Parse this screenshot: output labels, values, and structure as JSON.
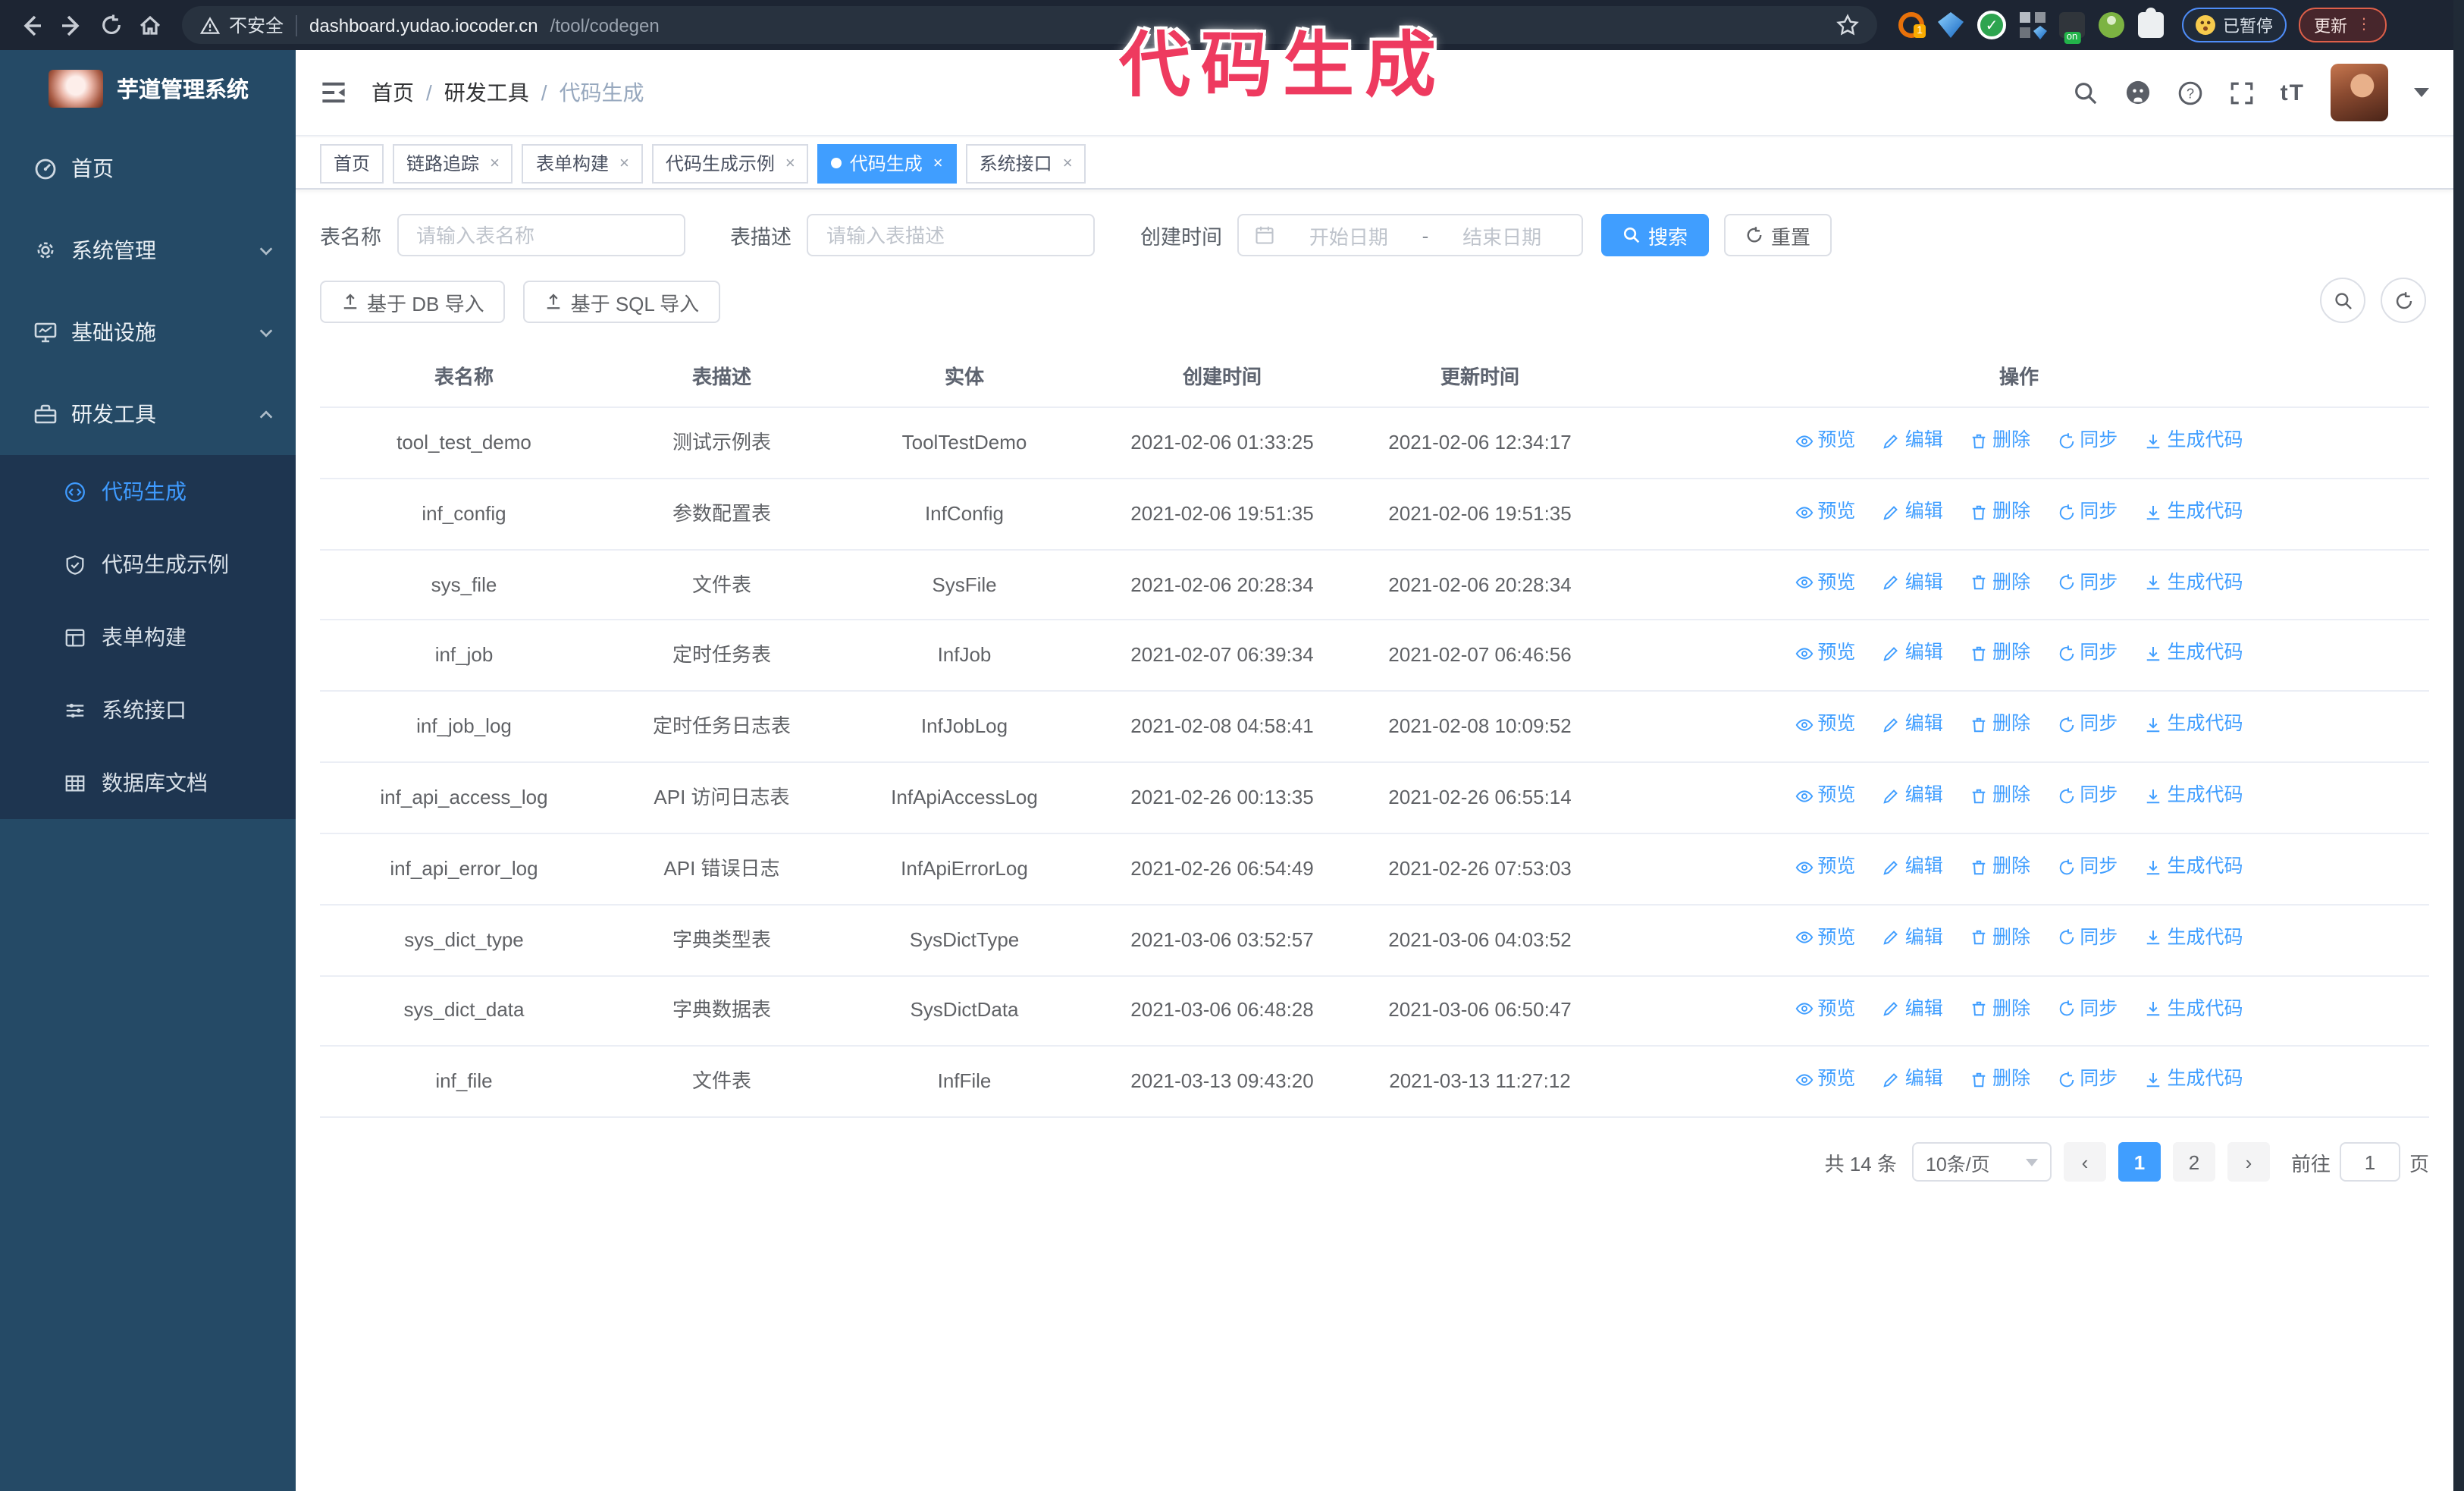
{
  "colors": {
    "accent": "#409eff",
    "sidebar_bg": "#254a66",
    "submenu_bg": "#1e3550",
    "chrome_bg": "#1d2533",
    "annotation": "#ee3a5f"
  },
  "browser": {
    "security_warning": "不安全",
    "url_host": "dashboard.yudao.iocoder.cn",
    "url_path": "/tool/codegen",
    "extension_badge": "1",
    "extension_on_badge": "on",
    "paused_badge": "已暂停",
    "update_button": "更新"
  },
  "annotation": {
    "text": "代码生成"
  },
  "sidebar": {
    "title": "芋道管理系统",
    "menu": [
      {
        "label": "首页",
        "icon": "dashboard-icon"
      },
      {
        "label": "系统管理",
        "icon": "gear-icon",
        "chevron": "down"
      },
      {
        "label": "基础设施",
        "icon": "monitor-icon",
        "chevron": "down"
      },
      {
        "label": "研发工具",
        "icon": "toolbox-icon",
        "chevron": "up"
      }
    ],
    "submenu": [
      {
        "label": "代码生成",
        "icon": "code-icon",
        "active": true
      },
      {
        "label": "代码生成示例",
        "icon": "example-icon"
      },
      {
        "label": "表单构建",
        "icon": "form-icon"
      },
      {
        "label": "系统接口",
        "icon": "api-icon"
      },
      {
        "label": "数据库文档",
        "icon": "database-icon"
      }
    ]
  },
  "breadcrumb": {
    "items": [
      "首页",
      "研发工具",
      "代码生成"
    ],
    "separator": "/"
  },
  "tabs": {
    "items": [
      {
        "label": "首页",
        "closable": false,
        "active": false
      },
      {
        "label": "链路追踪",
        "closable": true,
        "active": false
      },
      {
        "label": "表单构建",
        "closable": true,
        "active": false
      },
      {
        "label": "代码生成示例",
        "closable": true,
        "active": false
      },
      {
        "label": "代码生成",
        "closable": true,
        "active": true
      },
      {
        "label": "系统接口",
        "closable": true,
        "active": false
      }
    ]
  },
  "search": {
    "table_name_label": "表名称",
    "table_name_placeholder": "请输入表名称",
    "table_desc_label": "表描述",
    "table_desc_placeholder": "请输入表描述",
    "create_time_label": "创建时间",
    "date_start_placeholder": "开始日期",
    "date_separator": "-",
    "date_end_placeholder": "结束日期",
    "search_button": "搜索",
    "reset_button": "重置"
  },
  "toolbar": {
    "import_db_button": "基于 DB 导入",
    "import_sql_button": "基于 SQL 导入"
  },
  "table": {
    "columns": [
      "表名称",
      "表描述",
      "实体",
      "创建时间",
      "更新时间",
      "操作"
    ],
    "actions": [
      {
        "label": "预览",
        "icon": "eye-icon"
      },
      {
        "label": "编辑",
        "icon": "edit-icon"
      },
      {
        "label": "删除",
        "icon": "delete-icon"
      },
      {
        "label": "同步",
        "icon": "sync-icon"
      },
      {
        "label": "生成代码",
        "icon": "download-icon"
      }
    ],
    "rows": [
      {
        "name": "tool_test_demo",
        "description": "测试示例表",
        "entity": "ToolTestDemo",
        "created": "2021-02-06 01:33:25",
        "updated": "2021-02-06 12:34:17"
      },
      {
        "name": "inf_config",
        "description": "参数配置表",
        "entity": "InfConfig",
        "created": "2021-02-06 19:51:35",
        "updated": "2021-02-06 19:51:35"
      },
      {
        "name": "sys_file",
        "description": "文件表",
        "entity": "SysFile",
        "created": "2021-02-06 20:28:34",
        "updated": "2021-02-06 20:28:34"
      },
      {
        "name": "inf_job",
        "description": "定时任务表",
        "entity": "InfJob",
        "created": "2021-02-07 06:39:34",
        "updated": "2021-02-07 06:46:56"
      },
      {
        "name": "inf_job_log",
        "description": "定时任务日志表",
        "entity": "InfJobLog",
        "created": "2021-02-08 04:58:41",
        "updated": "2021-02-08 10:09:52"
      },
      {
        "name": "inf_api_access_log",
        "description": "API 访问日志表",
        "entity": "InfApiAccessLog",
        "created": "2021-02-26 00:13:35",
        "updated": "2021-02-26 06:55:14"
      },
      {
        "name": "inf_api_error_log",
        "description": "API 错误日志",
        "entity": "InfApiErrorLog",
        "created": "2021-02-26 06:54:49",
        "updated": "2021-02-26 07:53:03"
      },
      {
        "name": "sys_dict_type",
        "description": "字典类型表",
        "entity": "SysDictType",
        "created": "2021-03-06 03:52:57",
        "updated": "2021-03-06 04:03:52"
      },
      {
        "name": "sys_dict_data",
        "description": "字典数据表",
        "entity": "SysDictData",
        "created": "2021-03-06 06:48:28",
        "updated": "2021-03-06 06:50:47"
      },
      {
        "name": "inf_file",
        "description": "文件表",
        "entity": "InfFile",
        "created": "2021-03-13 09:43:20",
        "updated": "2021-03-13 11:27:12"
      }
    ]
  },
  "pagination": {
    "total": "共 14 条",
    "page_size": "10条/页",
    "prev": "‹",
    "next": "›",
    "pages": [
      "1",
      "2"
    ],
    "current": "1",
    "goto_label": "前往",
    "goto_value": "1",
    "goto_unit": "页"
  }
}
